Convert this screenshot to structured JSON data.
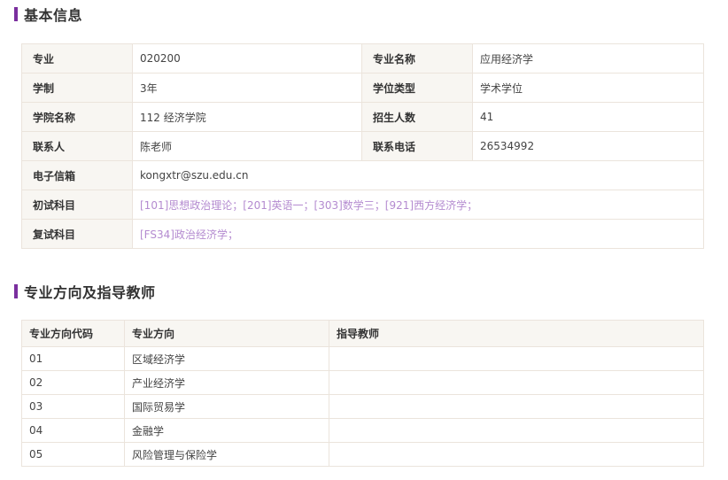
{
  "basic_info": {
    "title": "基本信息",
    "rows": [
      [
        {
          "label": "专业",
          "value": "020200"
        },
        {
          "label": "专业名称",
          "value": "应用经济学"
        }
      ],
      [
        {
          "label": "学制",
          "value": "3年"
        },
        {
          "label": "学位类型",
          "value": "学术学位"
        }
      ],
      [
        {
          "label": "学院名称",
          "value": "112 经济学院"
        },
        {
          "label": "招生人数",
          "value": "41"
        }
      ],
      [
        {
          "label": "联系人",
          "value": "陈老师"
        },
        {
          "label": "联系电话",
          "value": "26534992"
        }
      ]
    ],
    "email": {
      "label": "电子信箱",
      "value": "kongxtr@szu.edu.cn"
    },
    "prelim": {
      "label": "初试科目",
      "value": "[101]思想政治理论；[201]英语一；[303]数学三；[921]西方经济学；"
    },
    "retest": {
      "label": "复试科目",
      "value": "[FS34]政治经济学；"
    },
    "link_color": "#b48bd0"
  },
  "directions": {
    "title": "专业方向及指导教师",
    "headers": [
      "专业方向代码",
      "专业方向",
      "指导教师"
    ],
    "rows": [
      {
        "code": "01",
        "name": "区域经济学",
        "advisor": ""
      },
      {
        "code": "02",
        "name": "产业经济学",
        "advisor": ""
      },
      {
        "code": "03",
        "name": "国际贸易学",
        "advisor": ""
      },
      {
        "code": "04",
        "name": "金融学",
        "advisor": ""
      },
      {
        "code": "05",
        "name": "风险管理与保险学",
        "advisor": ""
      }
    ]
  },
  "accent_color": "#7a2f9e"
}
